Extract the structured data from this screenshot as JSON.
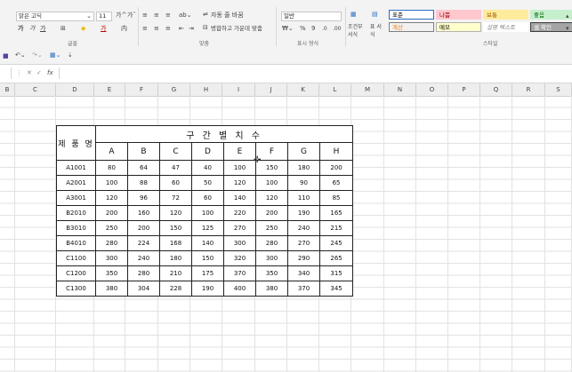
{
  "ribbon": {
    "font_name": "맑은 고딕",
    "font_size": "11",
    "grow_font": "가^",
    "shrink_font": "가ˇ",
    "bold": "가",
    "italic": "가",
    "underline": "가",
    "font_color_glyph": "가",
    "wrap_text": "자동 줄 바꿈",
    "merge_center": "병합하고 가운데 맞춤",
    "number_format": "일반",
    "percent": "%",
    "comma": "9",
    "cond_format": "조건부 서식",
    "table_format": "표 서식",
    "group_font": "글꼴",
    "group_align": "맞춤",
    "group_number": "표시 형식",
    "group_style": "스타일",
    "styles": [
      {
        "label": "표준",
        "bg": "#ffffff",
        "fg": "#000000",
        "border": "#2b6cc4"
      },
      {
        "label": "나쁨",
        "bg": "#ffc7ce",
        "fg": "#9c0006",
        "border": "#ffc7ce"
      },
      {
        "label": "보통",
        "bg": "#ffeb9c",
        "fg": "#9c5700",
        "border": "#ffeb9c"
      },
      {
        "label": "좋음",
        "bg": "#c6efce",
        "fg": "#006100",
        "border": "#c6efce"
      },
      {
        "label": "계산",
        "bg": "#f2f2f2",
        "fg": "#fa7d00",
        "border": "#7f7f7f"
      },
      {
        "label": "메모",
        "bg": "#ffffcc",
        "fg": "#000000",
        "border": "#b2b2b2"
      },
      {
        "label": "설명 텍스트",
        "bg": "#ffffff",
        "fg": "#7f7f7f",
        "border": "#ffffff"
      },
      {
        "label": "셀 확인",
        "bg": "#a5a5a5",
        "fg": "#ffffff",
        "border": "#3f3f3f"
      }
    ]
  },
  "formula_bar": {
    "cancel": "✕",
    "enter": "✓",
    "fx": "fx"
  },
  "columns": [
    "B",
    "C",
    "D",
    "E",
    "F",
    "G",
    "H",
    "I",
    "J",
    "K",
    "L",
    "M",
    "N",
    "O",
    "P",
    "Q",
    "R",
    "S"
  ],
  "table": {
    "row_header": "제 품 명",
    "title": "구 간 별 치 수",
    "col_headers": [
      "A",
      "B",
      "C",
      "D",
      "E",
      "F",
      "G",
      "H"
    ],
    "rows": [
      {
        "name": "A1001",
        "values": [
          "80",
          "64",
          "47",
          "40",
          "100",
          "150",
          "180",
          "200"
        ]
      },
      {
        "name": "A2001",
        "values": [
          "100",
          "88",
          "60",
          "50",
          "120",
          "100",
          "90",
          "65"
        ]
      },
      {
        "name": "A3001",
        "values": [
          "120",
          "96",
          "72",
          "60",
          "140",
          "120",
          "110",
          "85"
        ]
      },
      {
        "name": "B2010",
        "values": [
          "200",
          "160",
          "120",
          "100",
          "220",
          "200",
          "190",
          "165"
        ]
      },
      {
        "name": "B3010",
        "values": [
          "250",
          "200",
          "150",
          "125",
          "270",
          "250",
          "240",
          "215"
        ]
      },
      {
        "name": "B4010",
        "values": [
          "280",
          "224",
          "168",
          "140",
          "300",
          "280",
          "270",
          "245"
        ]
      },
      {
        "name": "C1100",
        "values": [
          "300",
          "240",
          "180",
          "150",
          "320",
          "300",
          "290",
          "265"
        ]
      },
      {
        "name": "C1200",
        "values": [
          "350",
          "280",
          "210",
          "175",
          "370",
          "350",
          "340",
          "315"
        ]
      },
      {
        "name": "C1300",
        "values": [
          "380",
          "304",
          "228",
          "190",
          "400",
          "380",
          "370",
          "345"
        ]
      }
    ]
  }
}
